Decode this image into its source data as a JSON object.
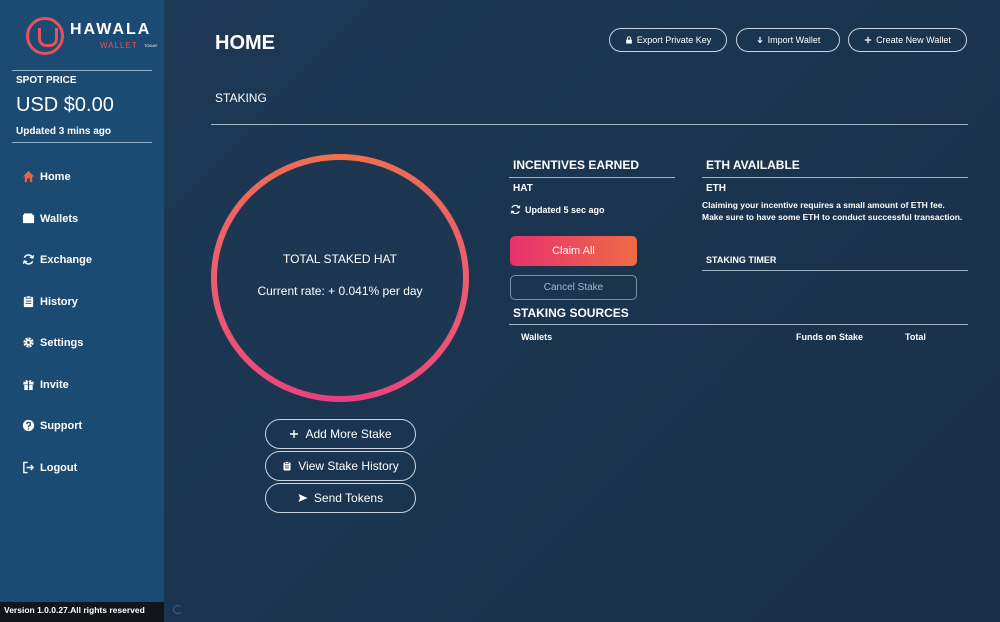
{
  "app": {
    "logo_title": "HAWALA",
    "logo_sub": "WALLET",
    "logo_sub_small": "TODAY"
  },
  "sidebar": {
    "spot_price_label": "SPOT PRICE",
    "spot_price_value": "USD $0.00",
    "updated_text": "Updated 3 mins ago",
    "items": [
      {
        "label": "Home",
        "icon": "home-icon"
      },
      {
        "label": "Wallets",
        "icon": "wallet-icon"
      },
      {
        "label": "Exchange",
        "icon": "exchange-icon"
      },
      {
        "label": "History",
        "icon": "history-icon"
      },
      {
        "label": "Settings",
        "icon": "gear-icon"
      },
      {
        "label": "Invite",
        "icon": "gift-icon"
      },
      {
        "label": "Support",
        "icon": "help-icon"
      },
      {
        "label": "Logout",
        "icon": "logout-icon"
      }
    ],
    "active_color": "#f0623f",
    "version_text": "Version 1.0.0.27.All rights reserved"
  },
  "header": {
    "title": "HOME",
    "export_label": "Export Private Key",
    "import_label": "Import Wallet",
    "create_label": "Create New Wallet"
  },
  "staking": {
    "section_title": "STAKING",
    "ring_title": "TOTAL STAKED HAT",
    "ring_rate": "Current rate: + 0.041% per day",
    "add_more_label": "Add More Stake",
    "history_label": "View Stake History",
    "send_label": "Send Tokens"
  },
  "incentives": {
    "title": "INCENTIVES EARNED",
    "token": "HAT",
    "updated": "Updated 5 sec ago",
    "claim_label": "Claim All",
    "cancel_label": "Cancel Stake"
  },
  "eth": {
    "title": "ETH AVAILABLE",
    "token": "ETH",
    "note_line1": "Claiming your incentive requires a small amount of ETH fee.",
    "note_line2": "Make sure to have some ETH to conduct successful transaction.",
    "timer_label": "STAKING TIMER"
  },
  "sources": {
    "title": "STAKING SOURCES",
    "columns": [
      "Wallets",
      "Funds on Stake",
      "Total"
    ]
  }
}
